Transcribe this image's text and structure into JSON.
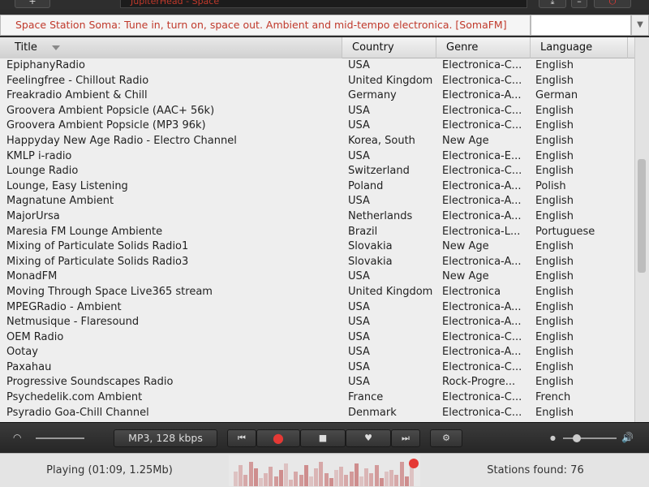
{
  "window": {
    "title": "JupiterHead - Space"
  },
  "now_playing": {
    "text": "Space Station Soma: Tune in, turn on, space out. Ambient and mid-tempo electronica. [SomaFM]"
  },
  "table": {
    "columns": [
      "Title",
      "Country",
      "Genre",
      "Language"
    ],
    "rows": [
      [
        "EpiphanyRadio",
        "USA",
        "Electronica-C...",
        "English"
      ],
      [
        "Feelingfree - Chillout Radio",
        "United Kingdom",
        "Electronica-C...",
        "English"
      ],
      [
        "Freakradio Ambient & Chill",
        "Germany",
        "Electronica-A...",
        "German"
      ],
      [
        "Groovera Ambient Popsicle (AAC+ 56k)",
        "USA",
        "Electronica-C...",
        "English"
      ],
      [
        "Groovera Ambient Popsicle (MP3 96k)",
        "USA",
        "Electronica-C...",
        "English"
      ],
      [
        "Happyday New Age Radio - Electro Channel",
        "Korea, South",
        "New Age",
        "English"
      ],
      [
        "KMLP i-radio",
        "USA",
        "Electronica-E...",
        "English"
      ],
      [
        "Lounge Radio",
        "Switzerland",
        "Electronica-C...",
        "English"
      ],
      [
        "Lounge, Easy Listening",
        "Poland",
        "Electronica-A...",
        "Polish"
      ],
      [
        "Magnatune Ambient",
        "USA",
        "Electronica-A...",
        "English"
      ],
      [
        "MajorUrsa",
        "Netherlands",
        "Electronica-A...",
        "English"
      ],
      [
        "Maresia FM Lounge Ambiente",
        "Brazil",
        "Electronica-L...",
        "Portuguese"
      ],
      [
        "Mixing of Particulate Solids Radio1",
        "Slovakia",
        "New Age",
        "English"
      ],
      [
        "Mixing of Particulate Solids Radio3",
        "Slovakia",
        "Electronica-A...",
        "English"
      ],
      [
        "MonadFM",
        "USA",
        "New Age",
        "English"
      ],
      [
        "Moving Through Space Live365 stream",
        "United Kingdom",
        "Electronica",
        "English"
      ],
      [
        "MPEGRadio - Ambient",
        "USA",
        "Electronica-A...",
        "English"
      ],
      [
        "Netmusique - Flaresound",
        "USA",
        "Electronica-A...",
        "English"
      ],
      [
        "OEM Radio",
        "USA",
        "Electronica-C...",
        "English"
      ],
      [
        "Ootay",
        "USA",
        "Electronica-A...",
        "English"
      ],
      [
        "Paxahau",
        "USA",
        "Electronica-C...",
        "English"
      ],
      [
        "Progressive Soundscapes Radio",
        "USA",
        "Rock-Progre...",
        "English"
      ],
      [
        "Psychedelik.com Ambient",
        "France",
        "Electronica-C...",
        "French"
      ],
      [
        "Psyradio Goa-Chill Channel",
        "Denmark",
        "Electronica-C...",
        "English"
      ]
    ]
  },
  "controls": {
    "format": "MP3, 128 kbps",
    "prev_icon": "skip-back-icon",
    "record_icon": "record-icon",
    "stop_icon": "stop-icon",
    "favorite_icon": "heart-icon",
    "next_icon": "skip-forward-icon",
    "settings_icon": "gear-icon"
  },
  "status": {
    "playing": "Playing (01:09, 1.25Mb)",
    "stations_found": "Stations found: 76"
  },
  "colors": {
    "accent": "#c0392b",
    "record": "#e53935"
  }
}
